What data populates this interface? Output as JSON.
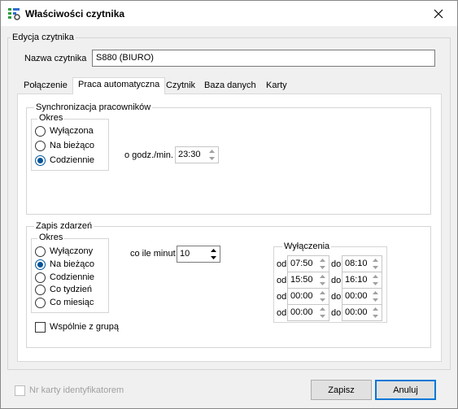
{
  "window": {
    "title": "Właściwości czytnika"
  },
  "reader": {
    "group_label": "Edycja czytnika",
    "name_label": "Nazwa czytnika",
    "name_value": "S880 (BIURO)"
  },
  "tabs": [
    {
      "label": "Połączenie",
      "active": false
    },
    {
      "label": "Praca automatyczna",
      "active": true
    },
    {
      "label": "Czytnik",
      "active": false
    },
    {
      "label": "Baza danych",
      "active": false
    },
    {
      "label": "Karty",
      "active": false
    }
  ],
  "sync": {
    "group_label": "Synchronizacja pracowników",
    "period_label": "Okres",
    "options": [
      "Wyłączona",
      "Na bieżąco",
      "Codziennie"
    ],
    "selected_index": 2,
    "time_label": "o godz./min.",
    "time_value": "23:30"
  },
  "events": {
    "group_label": "Zapis zdarzeń",
    "period_label": "Okres",
    "options": [
      "Wyłączony",
      "Na bieżąco",
      "Codziennie",
      "Co tydzień",
      "Co miesiąc"
    ],
    "selected_index": 1,
    "interval_label": "co ile minut",
    "interval_value": "10",
    "group_checkbox_label": "Wspólnie z grupą",
    "group_checkbox_checked": false,
    "exclusions": {
      "label": "Wyłączenia",
      "from_label": "od",
      "to_label": "do",
      "rows": [
        {
          "from": "07:50",
          "to": "08:10"
        },
        {
          "from": "15:50",
          "to": "16:10"
        },
        {
          "from": "00:00",
          "to": "00:00"
        },
        {
          "from": "00:00",
          "to": "00:00"
        }
      ]
    }
  },
  "footer": {
    "card_id_label": "Nr karty identyfikatorem",
    "save_label": "Zapisz",
    "cancel_label": "Anuluj"
  }
}
